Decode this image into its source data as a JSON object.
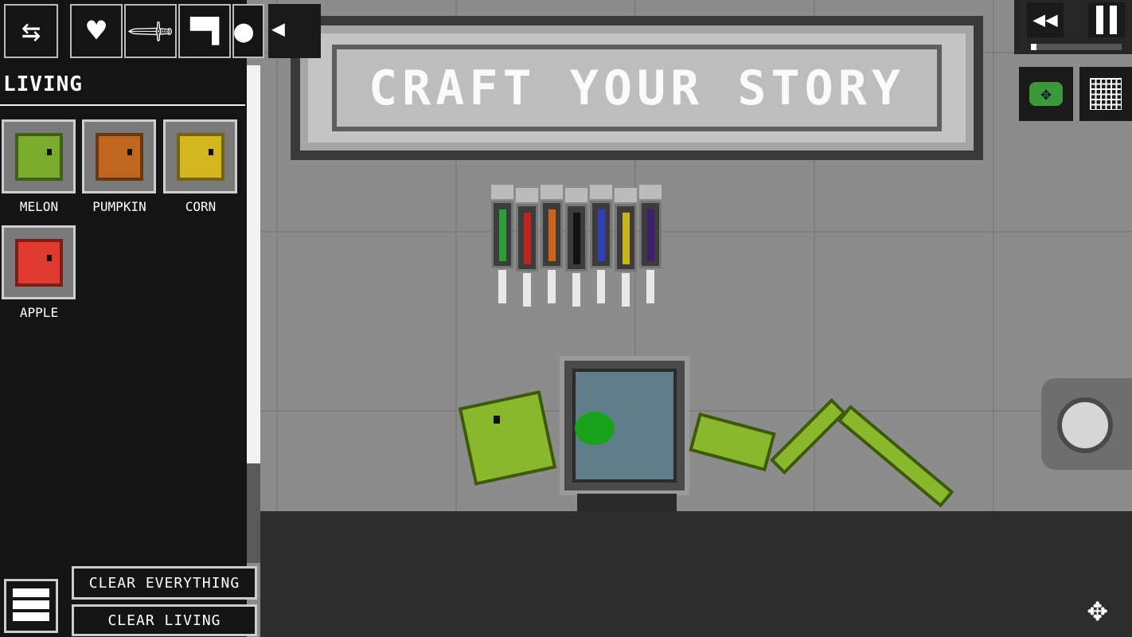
{
  "toolbar": {
    "icons": [
      "swap-arrows-icon",
      "heart-icon",
      "sword-icon",
      "pistol-icon",
      "grenade-icon"
    ],
    "collapse_icon": "collapse-arrow-icon"
  },
  "sidebar": {
    "category": "LIVING",
    "items": [
      {
        "label": "MELON",
        "color": "#7aab2a"
      },
      {
        "label": "PUMPKIN",
        "color": "#c0661e"
      },
      {
        "label": "CORN",
        "color": "#d4b61f"
      },
      {
        "label": "APPLE",
        "color": "#e03b2e"
      }
    ],
    "menu_icon": "menu-icon",
    "clear_everything": "CLEAR EVERYTHING",
    "clear_living": "CLEAR LIVING"
  },
  "banner": {
    "title": "CRAFT YOUR STORY"
  },
  "syringes": [
    "#2aa138",
    "#c0241f",
    "#d0631c",
    "#111111",
    "#2f3fb5",
    "#c8b51e",
    "#3a1f6e"
  ],
  "controls": {
    "rewind_icon": "rewind-icon",
    "pause_icon": "pause-icon",
    "time_progress": 0.06,
    "camera_icon": "camera-move-icon",
    "grid_icon": "grid-icon",
    "joystick": "joystick",
    "move_icon": "move-arrows-icon"
  }
}
